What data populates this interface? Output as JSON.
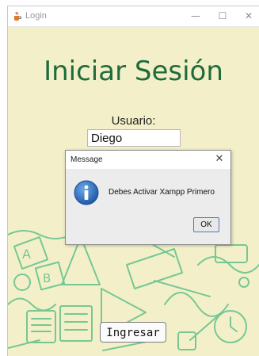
{
  "window": {
    "title": "Login",
    "controls": {
      "minimize": "—",
      "maximize": "☐",
      "close": "✕"
    }
  },
  "login": {
    "heading": "Iniciar Sesión",
    "user_label": "Usuario:",
    "user_value": "Diego",
    "submit_label": "Ingresar"
  },
  "dialog": {
    "title": "Message",
    "close": "✕",
    "message": "Debes Activar Xampp Primero",
    "ok_label": "OK"
  },
  "colors": {
    "background": "#f3f0c9",
    "heading": "#1f6b3c",
    "doodles": "#5fbf8a",
    "info_icon": "#2d6fc1"
  },
  "icons": {
    "app": "java-cup-icon",
    "info": "info-icon"
  }
}
